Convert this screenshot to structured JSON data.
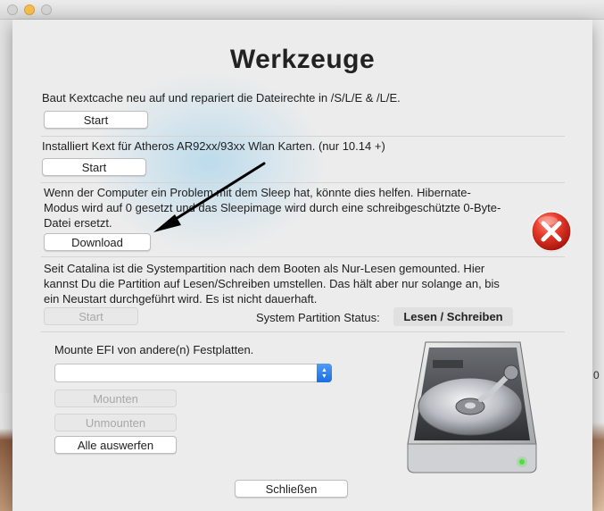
{
  "window": {
    "peek_text": "0"
  },
  "sheet": {
    "title": "Werkzeuge",
    "sections": [
      {
        "text": "Baut Kextcache neu auf und repariert die Dateirechte in /S/L/E & /L/E.",
        "button": "Start",
        "enabled": true
      },
      {
        "text": "Installiert Kext für Atheros AR92xx/93xx Wlan Karten. (nur 10.14 +)",
        "button": "Start",
        "enabled": true
      },
      {
        "text": "Wenn der Computer ein Problem mit dem Sleep hat, könnte dies helfen. Hibernate-Modus wird auf 0 gesetzt und das Sleepimage wird durch eine schreibgeschützte 0-Byte-Datei ersetzt.",
        "button": "Download",
        "enabled": true
      },
      {
        "text": "Seit Catalina ist die Systempartition nach dem Booten als Nur-Lesen gemounted. Hier kannst Du die Partition auf Lesen/Schreiben umstellen. Das hält aber nur solange an, bis ein Neustart durchgeführt wird. Es ist nicht dauerhaft.",
        "button": "Start",
        "enabled": false
      }
    ],
    "partition_status": {
      "label": "System Partition Status:",
      "value": "Lesen / Schreiben"
    },
    "efi": {
      "label": "Mounte EFI von andere(n) Festplatten.",
      "select_value": "",
      "mount_button": "Mounten",
      "unmount_button": "Unmounten",
      "eject_all_button": "Alle auswerfen"
    },
    "close_button": "Schließen",
    "icons": {
      "error": "close-circle-icon",
      "disk": "hard-drive-icon",
      "arrow": "arrow-annotation"
    },
    "colors": {
      "accent": "#1a6fe3",
      "error_red": "#e53b2c",
      "led_green": "#4ede3e"
    }
  }
}
